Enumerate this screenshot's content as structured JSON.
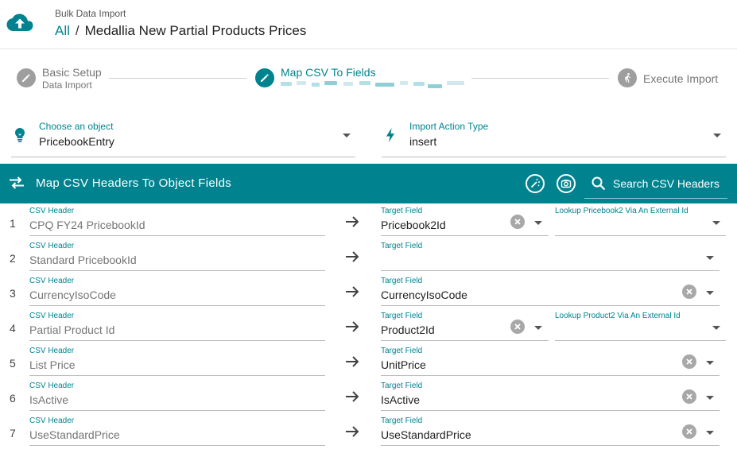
{
  "header": {
    "app_name": "Bulk Data Import",
    "breadcrumb_root": "All",
    "breadcrumb_separator": "/",
    "title": "Medallia New Partial Products Prices",
    "icon": "cloud-upload-icon"
  },
  "stepper": {
    "steps": [
      {
        "title": "Basic Setup",
        "subtitle": "Data Import",
        "state": "complete",
        "icon": "pencil-icon"
      },
      {
        "title": "Map CSV To Fields",
        "subtitle": "",
        "state": "active",
        "icon": "pencil-icon"
      },
      {
        "title": "Execute Import",
        "subtitle": "",
        "state": "pending",
        "icon": "running-person-icon"
      }
    ]
  },
  "object_selector": {
    "label": "Choose an object",
    "value": "PricebookEntry",
    "icon": "lightbulb-icon"
  },
  "action_selector": {
    "label": "Import Action Type",
    "value": "insert",
    "icon": "lightning-bolt-icon"
  },
  "toolbar": {
    "title": "Map CSV Headers To Object Fields",
    "search_placeholder": "Search CSV Headers",
    "icons": [
      "swap-arrows-icon",
      "magic-wand-icon",
      "camera-icon",
      "search-icon"
    ]
  },
  "mapping_rows": [
    {
      "index": "1",
      "csv_label": "CSV Header",
      "csv_value": "CPQ FY24 PricebookId",
      "target_label": "Target Field",
      "target_value": "Pricebook2Id",
      "lookup_label": "Lookup Pricebook2 Via An External Id",
      "lookup_value": ""
    },
    {
      "index": "2",
      "csv_label": "CSV Header",
      "csv_value": "Standard PricebookId",
      "target_label": "Target Field",
      "target_value": ""
    },
    {
      "index": "3",
      "csv_label": "CSV Header",
      "csv_value": "CurrencyIsoCode",
      "target_label": "Target Field",
      "target_value": "CurrencyIsoCode"
    },
    {
      "index": "4",
      "csv_label": "CSV Header",
      "csv_value": "Partial Product Id",
      "target_label": "Target Field",
      "target_value": "Product2Id",
      "lookup_label": "Lookup Product2 Via An External Id",
      "lookup_value": ""
    },
    {
      "index": "5",
      "csv_label": "CSV Header",
      "csv_value": "List Price",
      "target_label": "Target Field",
      "target_value": "UnitPrice"
    },
    {
      "index": "6",
      "csv_label": "CSV Header",
      "csv_value": "IsActive",
      "target_label": "Target Field",
      "target_value": "IsActive"
    },
    {
      "index": "7",
      "csv_label": "CSV Header",
      "csv_value": "UseStandardPrice",
      "target_label": "Target Field",
      "target_value": "UseStandardPrice"
    }
  ],
  "colors": {
    "accent": "#00838f",
    "step_inactive": "#9e9e9e",
    "clear_button": "#a8a8a8"
  }
}
